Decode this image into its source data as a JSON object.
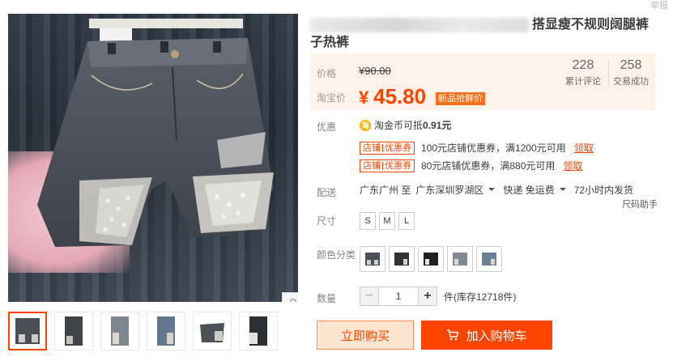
{
  "top_link": "举报",
  "title": {
    "line1": "搭显瘦不规则阔腿裤",
    "line2": "子热裤"
  },
  "price": {
    "original_label": "价格",
    "original_value": "¥90.00",
    "current_label": "淘宝价",
    "currency": "¥",
    "current_value": "45.80",
    "badge": "新品抢鲜价"
  },
  "stats": [
    {
      "num": "228",
      "label": "累计评论"
    },
    {
      "num": "258",
      "label": "交易成功"
    }
  ],
  "promo": {
    "label": "优惠",
    "coin_icon": "淘",
    "coin_text": "淘金币可抵",
    "coin_value": "0.91元",
    "coupon_tag_a": "店铺",
    "coupon_tag_b": "优惠券",
    "coupons": [
      {
        "text": "100元店铺优惠券，满1200元可用",
        "claim": "领取"
      },
      {
        "text": "80元店铺优惠券，满880元可用",
        "claim": "领取"
      }
    ]
  },
  "delivery": {
    "label": "配送",
    "from": "广东广州 至",
    "to": "广东深圳罗湖区",
    "method": "快递 免运费",
    "time": "72小时内发货"
  },
  "size": {
    "label": "尺寸",
    "helper": "尺码助手",
    "options": [
      "S",
      "M",
      "L"
    ]
  },
  "color": {
    "label": "颜色分类",
    "count": 5
  },
  "quantity": {
    "label": "数量",
    "value": "1",
    "minus": "−",
    "plus": "+",
    "stock": "件(库存12718件)"
  },
  "buttons": {
    "buy_now": "立即购买",
    "add_cart": "加入购物车"
  },
  "gallery": {
    "thumb_count": 6,
    "zoom_icon": "magnifier-icon"
  },
  "colors": {
    "accent": "#ff4400",
    "price_bg": "#fff2e8"
  }
}
